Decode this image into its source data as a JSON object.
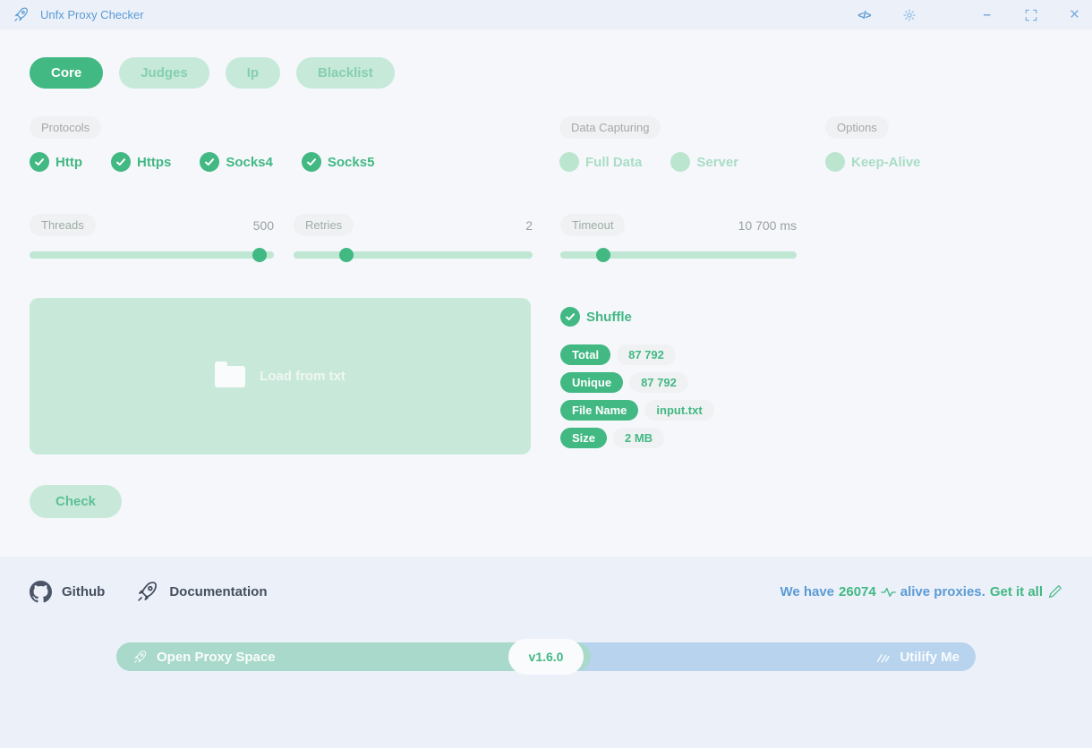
{
  "titlebar": {
    "title": "Unfx Proxy Checker",
    "code_icon_text": "</>",
    "minimize_glyph": "–",
    "close_glyph": "×"
  },
  "tabs": [
    {
      "label": "Core",
      "active": true
    },
    {
      "label": "Judges",
      "active": false
    },
    {
      "label": "Ip",
      "active": false
    },
    {
      "label": "Blacklist",
      "active": false
    }
  ],
  "protocols": {
    "label": "Protocols",
    "items": [
      {
        "label": "Http",
        "checked": true
      },
      {
        "label": "Https",
        "checked": true
      },
      {
        "label": "Socks4",
        "checked": true
      },
      {
        "label": "Socks5",
        "checked": true
      }
    ]
  },
  "data_capturing": {
    "label": "Data Capturing",
    "items": [
      {
        "label": "Full Data",
        "checked": false
      },
      {
        "label": "Server",
        "checked": false
      }
    ]
  },
  "options": {
    "label": "Options",
    "items": [
      {
        "label": "Keep-Alive",
        "checked": false
      }
    ]
  },
  "sliders": [
    {
      "label": "Threads",
      "value": "500",
      "percent": 94
    },
    {
      "label": "Retries",
      "value": "2",
      "percent": 22
    },
    {
      "label": "Timeout",
      "value": "10 700 ms",
      "percent": 18
    }
  ],
  "load_area": {
    "label": "Load from txt"
  },
  "shuffle": {
    "label": "Shuffle",
    "checked": true
  },
  "stats": [
    {
      "key": "Total",
      "value": "87 792"
    },
    {
      "key": "Unique",
      "value": "87 792"
    },
    {
      "key": "File Name",
      "value": "input.txt"
    },
    {
      "key": "Size",
      "value": "2 MB"
    }
  ],
  "check_button": {
    "label": "Check"
  },
  "footer": {
    "github_label": "Github",
    "documentation_label": "Documentation",
    "promo": {
      "prefix": "We have",
      "count": "26074",
      "middle": "alive proxies.",
      "cta": "Get it all"
    }
  },
  "bottom_bar": {
    "left_label": "Open Proxy Space",
    "version": "v1.6.0",
    "right_label": "Utilify Me"
  },
  "colors": {
    "accent": "#42b883",
    "accent_light": "#c8e9da",
    "blue": "#5b9bd5",
    "bar_teal": "#a9d9ca",
    "bar_blue": "#b7d3ed"
  }
}
